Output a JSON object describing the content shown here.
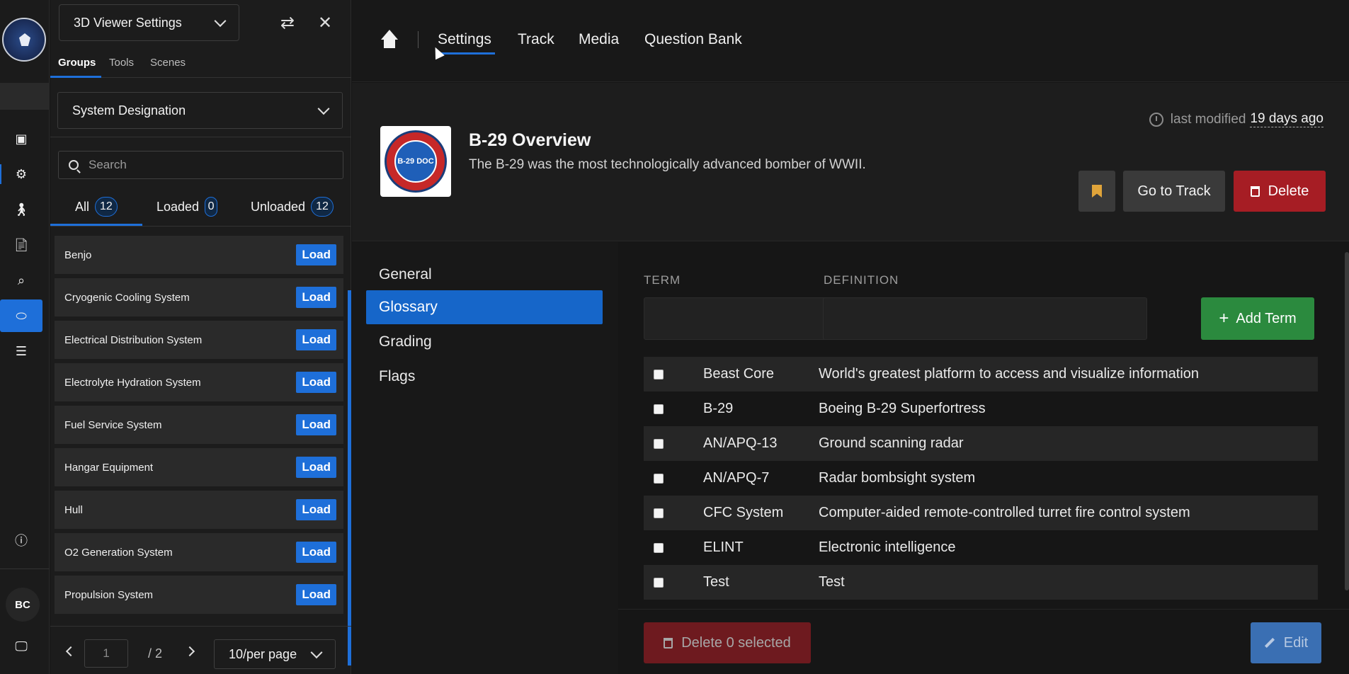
{
  "rail": {
    "icons": [
      "logo-emblem",
      "cube-icon",
      "gear-icon",
      "walking-person-icon",
      "document-icon",
      "search-icon",
      "gamepad-icon",
      "list-icon",
      "info-icon",
      "monitor-icon"
    ],
    "avatar": "BC"
  },
  "panel": {
    "title": "3D Viewer Settings",
    "tabs": [
      "Groups",
      "Tools",
      "Scenes"
    ],
    "group_select": "System Designation",
    "search_placeholder": "Search",
    "filters": [
      {
        "label": "All",
        "count": "12"
      },
      {
        "label": "Loaded",
        "count": "0"
      },
      {
        "label": "Unloaded",
        "count": "12"
      }
    ],
    "load_label": "Load",
    "items": [
      "Benjo",
      "Cryogenic Cooling System",
      "Electrical Distribution System",
      "Electrolyte Hydration System",
      "Fuel Service System",
      "Hangar Equipment",
      "Hull",
      "O2 Generation System",
      "Propulsion System"
    ],
    "page": "1",
    "total_pages": "/ 2",
    "per_page": "10/per page"
  },
  "nav": {
    "links": [
      "Settings",
      "Track",
      "Media",
      "Question Bank"
    ],
    "active": "Settings"
  },
  "hero": {
    "title": "B-29 Overview",
    "description": "The B-29 was the most technologically advanced bomber of WWII.",
    "badge_text": "B-29 DOC",
    "modified_label": "last modified",
    "modified_ago": "19 days ago",
    "go_to_track": "Go to Track",
    "delete": "Delete"
  },
  "subnav": [
    "General",
    "Glossary",
    "Grading",
    "Flags"
  ],
  "glossary": {
    "term_label": "TERM",
    "definition_label": "DEFINITION",
    "add_term": "Add Term",
    "rows": [
      {
        "term": "Beast Core",
        "definition": "World's greatest platform to access and visualize information"
      },
      {
        "term": "B-29",
        "definition": "Boeing B-29 Superfortress"
      },
      {
        "term": "AN/APQ-13",
        "definition": "Ground scanning radar"
      },
      {
        "term": "AN/APQ-7",
        "definition": "Radar bombsight system"
      },
      {
        "term": "CFC System",
        "definition": "Computer-aided remote-controlled turret fire control system"
      },
      {
        "term": "ELINT",
        "definition": "Electronic intelligence"
      },
      {
        "term": "Test",
        "definition": "Test"
      }
    ],
    "delete_selected": "Delete 0 selected",
    "edit": "Edit"
  },
  "colors": {
    "accent": "#1e6fd9",
    "danger": "#a61d24",
    "success": "#2b8a3e",
    "bookmark": "#e0a43a"
  }
}
